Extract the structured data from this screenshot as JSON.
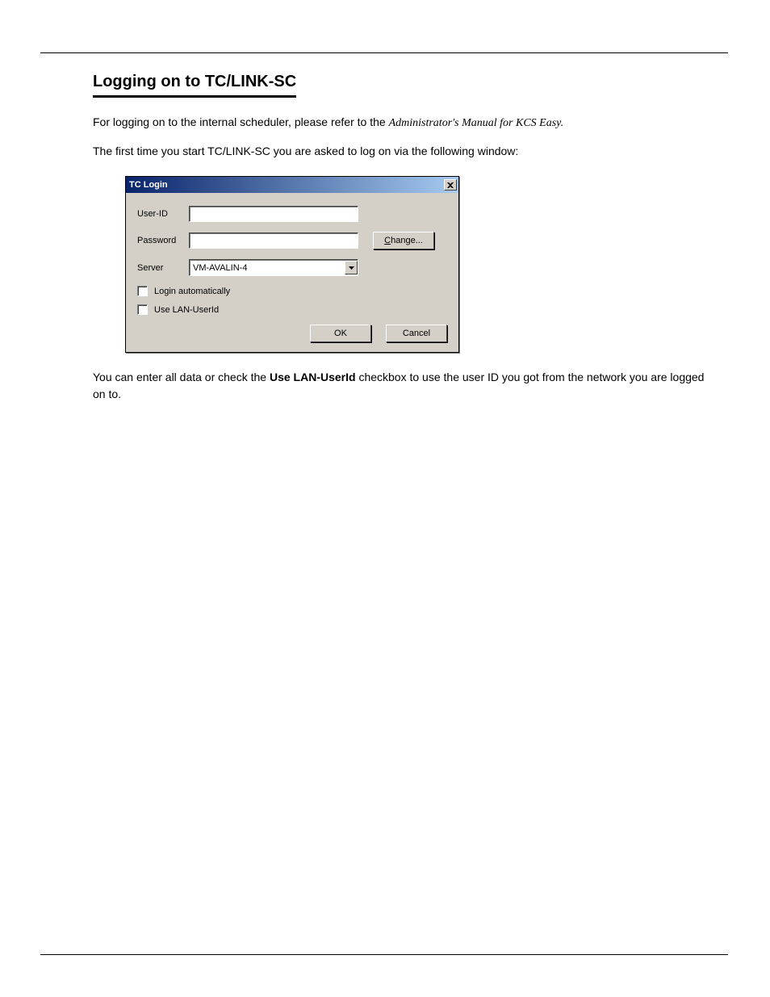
{
  "section": {
    "title": "Logging on to TC/LINK-SC",
    "p1_prefix": "For logging on to the internal scheduler, please refer to the ",
    "p1_italic": "Administrator's Manual for KCS Easy.",
    "p2": "The first time you start TC/LINK-SC you are asked to log on via the following window:",
    "p3_prefix": "You can enter all data or check the ",
    "p3_bold": "Use LAN-UserId",
    "p3_suffix": " checkbox to use the user ID you got from the network you are logged on to."
  },
  "dialog": {
    "title": "TC Login",
    "user_id_label": "User-ID",
    "password_label": "Password",
    "server_label": "Server",
    "server_value": "VM-AVALIN-4",
    "change_btn": "Change...",
    "login_auto_label": "Login automatically",
    "use_lan_label": "Use LAN-UserId",
    "ok_btn": "OK",
    "cancel_btn": "Cancel"
  }
}
